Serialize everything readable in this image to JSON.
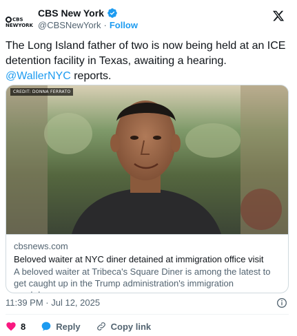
{
  "author": {
    "display_name": "CBS New York",
    "handle": "@CBSNewYork",
    "separator": "·",
    "follow_label": "Follow",
    "avatar_text_line1": "CBS",
    "avatar_text_line2": "NEWYORK",
    "verified_color": "#1d9bf0"
  },
  "tweet": {
    "text_before": "The Long Island father of two is now being held at an ICE detention facility in Texas, awaiting a hearing. ",
    "mention": "@WallerNYC",
    "text_after": " reports."
  },
  "card": {
    "image_credit": "CREDIT: DONNA FERRATO",
    "domain": "cbsnews.com",
    "title": "Beloved waiter at NYC diner detained at immigration office visit",
    "description": "A beloved waiter at Tribeca's Square Diner is among the latest to get caught up in the Trump administration's immigration crackdown."
  },
  "meta": {
    "timestamp": "11:39 PM · Jul 12, 2025"
  },
  "actions": {
    "like_count": "8",
    "reply_label": "Reply",
    "copy_link_label": "Copy link",
    "like_color": "#f91880",
    "reply_color": "#1d9bf0"
  },
  "icons": [
    "x-logo-icon",
    "verified-icon",
    "info-icon",
    "heart-icon",
    "reply-icon",
    "link-icon"
  ]
}
